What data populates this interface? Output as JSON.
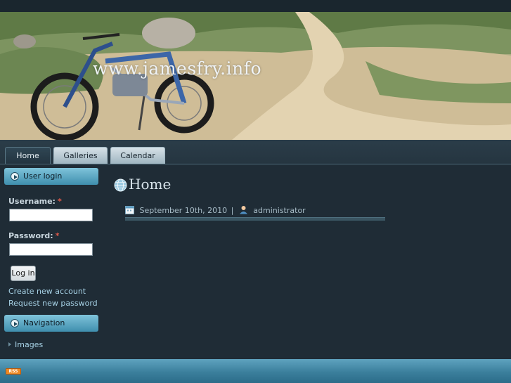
{
  "header": {
    "site_title": "www.jamesfry.info"
  },
  "nav": {
    "tabs": [
      {
        "label": "Home",
        "active": true
      },
      {
        "label": "Galleries",
        "active": false
      },
      {
        "label": "Calendar",
        "active": false
      }
    ]
  },
  "sidebar": {
    "login_block": {
      "title": "User login",
      "username_label": "Username:",
      "password_label": "Password:",
      "required_marker": "*",
      "username_value": "",
      "password_value": "",
      "login_button": "Log in",
      "create_account": "Create new account",
      "request_password": "Request new password"
    },
    "navigation_block": {
      "title": "Navigation",
      "items": [
        "Images"
      ]
    }
  },
  "main": {
    "title": "Home",
    "date": "September 10th, 2010",
    "separator": "|",
    "author": "administrator"
  },
  "footer": {
    "rss_badge": "RSS"
  },
  "colors": {
    "background": "#1f2c36",
    "accent_blue": "#3f8fae",
    "link": "#a7d2e6",
    "required": "#e05a4a",
    "rss": "#f08a24"
  }
}
